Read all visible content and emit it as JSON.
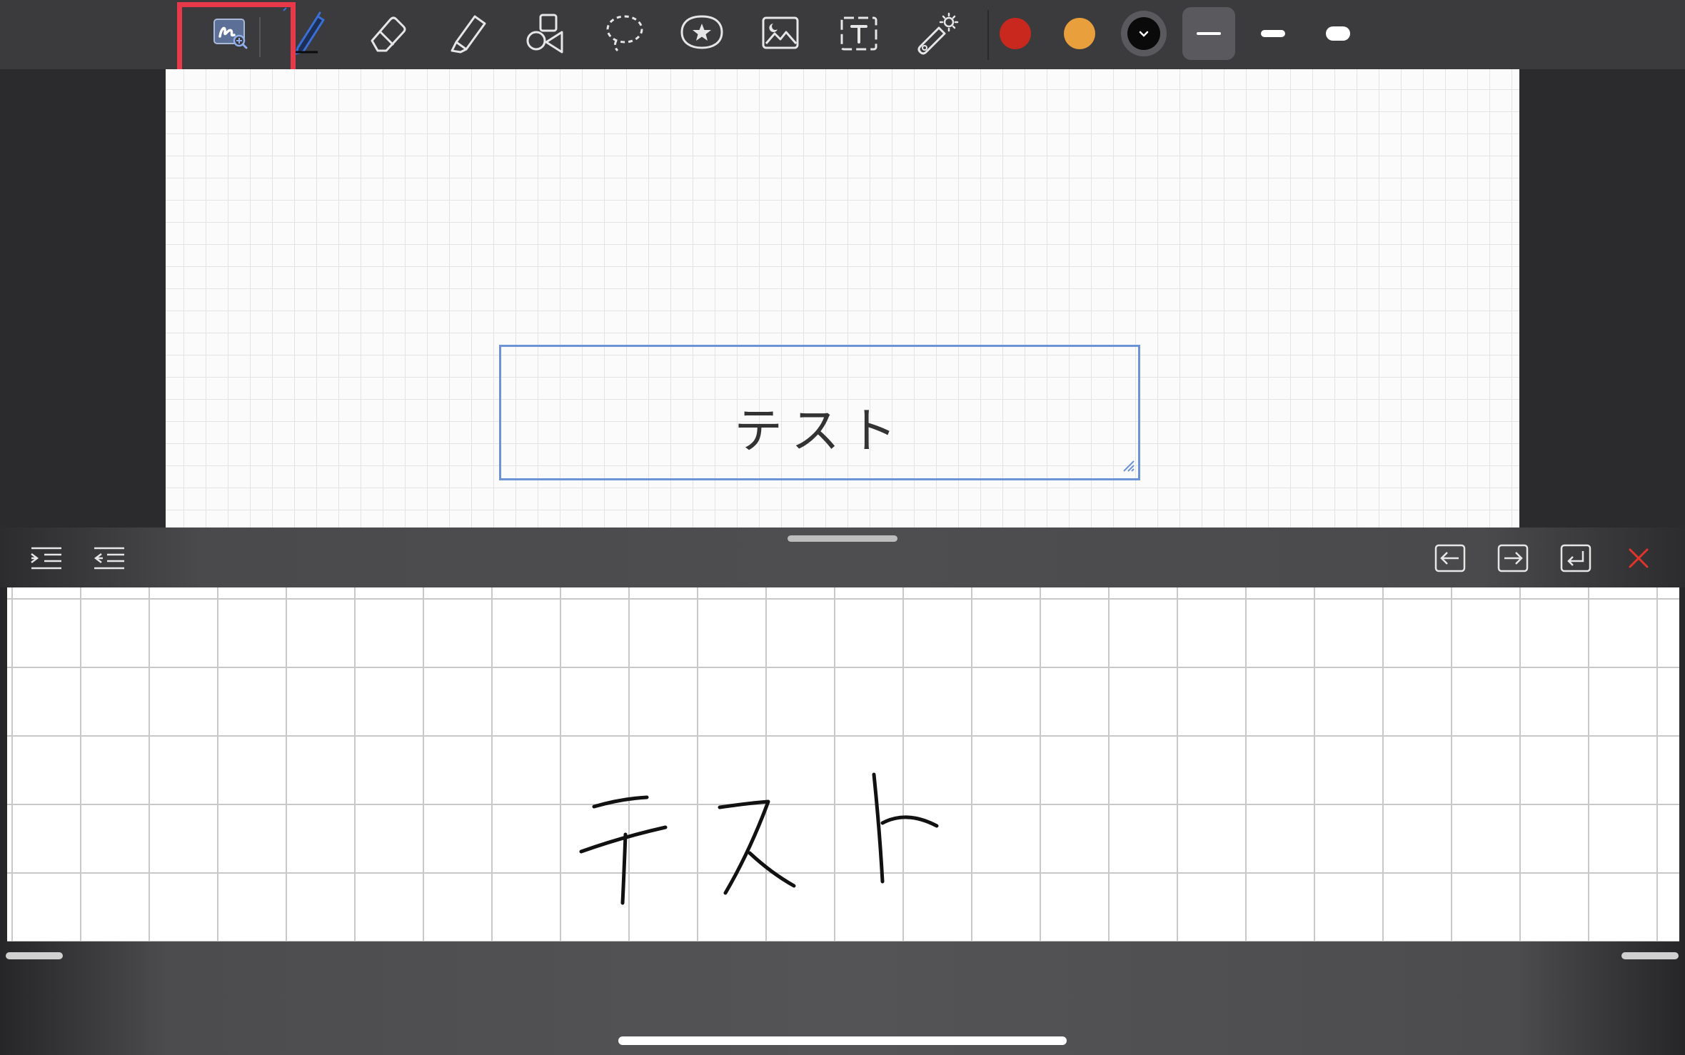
{
  "toolbar": {
    "tools": [
      {
        "name": "handwriting-recognition",
        "icon": "handwriting-zoom-icon",
        "selected": true
      },
      {
        "name": "pen",
        "icon": "pen-icon"
      },
      {
        "name": "eraser",
        "icon": "eraser-icon"
      },
      {
        "name": "highlighter",
        "icon": "highlighter-icon"
      },
      {
        "name": "shapes",
        "icon": "shapes-icon"
      },
      {
        "name": "lasso",
        "icon": "lasso-icon"
      },
      {
        "name": "stickers",
        "icon": "star-sticker-icon"
      },
      {
        "name": "image",
        "icon": "image-icon"
      },
      {
        "name": "text",
        "icon": "text-box-icon"
      },
      {
        "name": "laser-pointer",
        "icon": "laser-pointer-icon"
      }
    ],
    "colors": [
      "#c8281e",
      "#e9a03c",
      "#0a0a0a"
    ],
    "selected_color": "#0a0a0a",
    "stroke_widths": [
      "thin",
      "medium",
      "thick"
    ],
    "selected_width": "thin",
    "accent": "#3b6fd8"
  },
  "canvas": {
    "text_box": {
      "text": "テスト"
    }
  },
  "panel": {
    "left_tools": [
      {
        "name": "indent",
        "icon": "indent-icon"
      },
      {
        "name": "outdent",
        "icon": "outdent-icon"
      }
    ],
    "right_tools": [
      {
        "name": "move-left",
        "icon": "arrow-left-box-icon"
      },
      {
        "name": "move-right",
        "icon": "arrow-right-box-icon"
      },
      {
        "name": "new-line",
        "icon": "return-icon"
      },
      {
        "name": "close",
        "icon": "close-icon",
        "color": "#e0342a"
      }
    ],
    "handwriting_text": "テスト"
  }
}
